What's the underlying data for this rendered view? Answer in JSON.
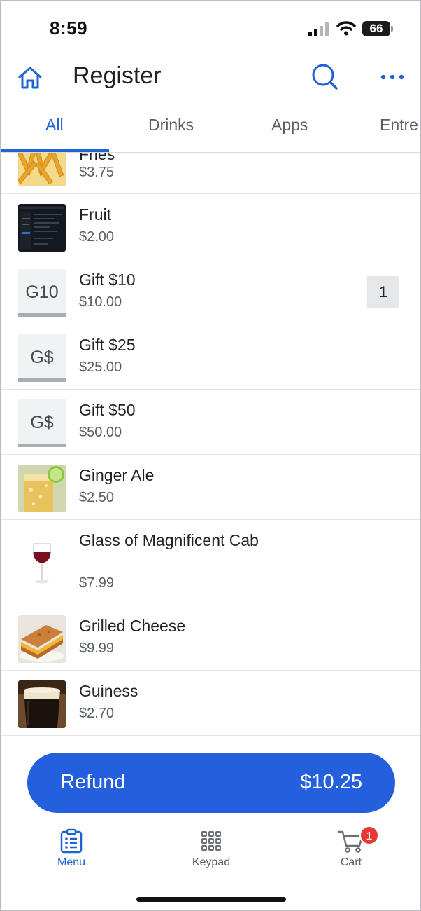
{
  "status_bar": {
    "time": "8:59",
    "battery": "66"
  },
  "header": {
    "title": "Register",
    "home_icon": "home-icon",
    "search_icon": "search-icon",
    "more_icon": "more-horizontal-icon"
  },
  "tabs": [
    {
      "label": "All",
      "active": true
    },
    {
      "label": "Drinks",
      "active": false
    },
    {
      "label": "Apps",
      "active": false
    },
    {
      "label": "Entre",
      "active": false
    }
  ],
  "items": [
    {
      "name": "Fries",
      "price": "$3.75",
      "thumb": "fries-photo"
    },
    {
      "name": "Fruit",
      "price": "$2.00",
      "thumb": "screenshot-thumbnail"
    },
    {
      "name": "Gift $10",
      "price": "$10.00",
      "thumb_text": "G10",
      "quantity": "1"
    },
    {
      "name": "Gift $25",
      "price": "$25.00",
      "thumb_text": "G$"
    },
    {
      "name": "Gift $50",
      "price": "$50.00",
      "thumb_text": "G$"
    },
    {
      "name": "Ginger Ale",
      "price": "$2.50",
      "thumb": "ginger-ale-photo"
    },
    {
      "name": "Glass of Magnificent Cab",
      "price": "$7.99",
      "thumb": "red-wine-photo"
    },
    {
      "name": "Grilled Cheese",
      "price": "$9.99",
      "thumb": "grilled-cheese-photo"
    },
    {
      "name": "Guiness",
      "price": "$2.70",
      "thumb": "stout-beer-photo"
    }
  ],
  "refund": {
    "label": "Refund",
    "amount": "$10.25"
  },
  "bottom_nav": [
    {
      "label": "Menu",
      "icon": "clipboard-list-icon",
      "active": true
    },
    {
      "label": "Keypad",
      "icon": "keypad-grid-icon",
      "active": false
    },
    {
      "label": "Cart",
      "icon": "cart-icon",
      "active": false,
      "badge": "1"
    }
  ],
  "colors": {
    "accent": "#1e63d6",
    "button": "#2460de",
    "badge": "#e53935"
  }
}
